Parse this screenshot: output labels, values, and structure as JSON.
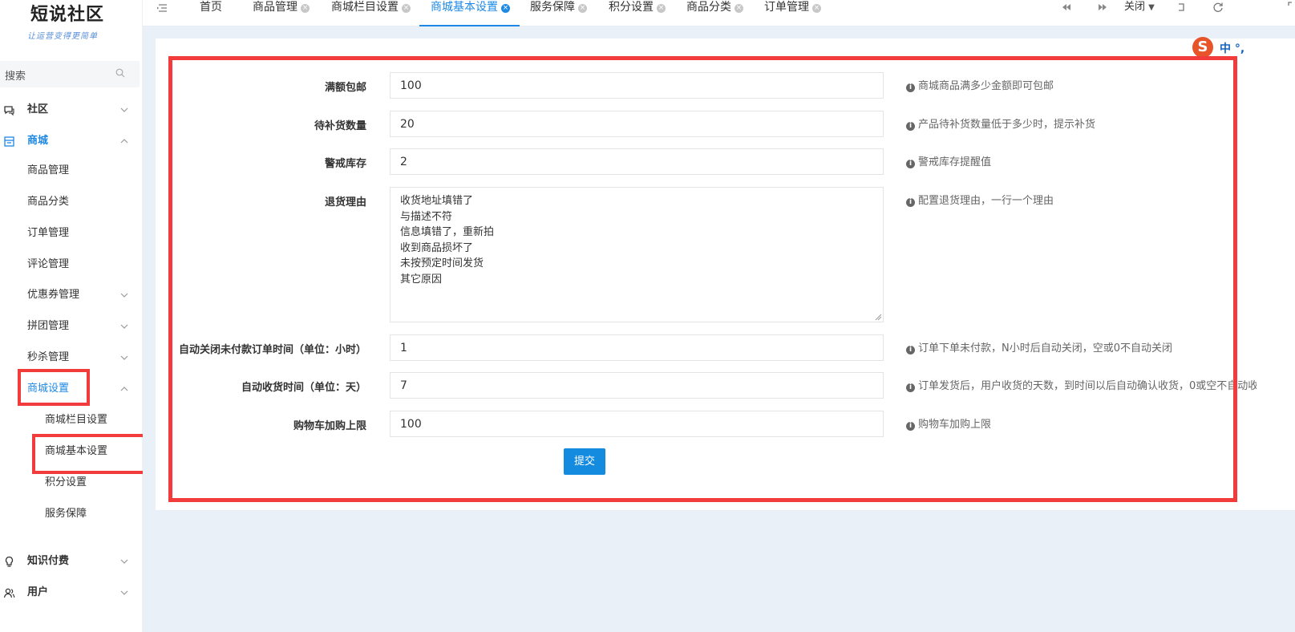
{
  "brand": {
    "title": "短说社区",
    "subtitle": "让运营变得更简单"
  },
  "sidebar": {
    "search_placeholder": "搜索",
    "items": [
      {
        "label": "社区"
      },
      {
        "label": "商城"
      },
      {
        "label": "商品管理"
      },
      {
        "label": "商品分类"
      },
      {
        "label": "订单管理"
      },
      {
        "label": "评论管理"
      },
      {
        "label": "优惠券管理"
      },
      {
        "label": "拼团管理"
      },
      {
        "label": "秒杀管理"
      },
      {
        "label": "商城设置"
      },
      {
        "label": "商城栏目设置"
      },
      {
        "label": "商城基本设置"
      },
      {
        "label": "积分设置"
      },
      {
        "label": "服务保障"
      },
      {
        "label": "知识付费"
      },
      {
        "label": "用户"
      }
    ]
  },
  "tabs": [
    {
      "label": "首页"
    },
    {
      "label": "商品管理"
    },
    {
      "label": "商城栏目设置"
    },
    {
      "label": "商城基本设置"
    },
    {
      "label": "服务保障"
    },
    {
      "label": "积分设置"
    },
    {
      "label": "商品分类"
    },
    {
      "label": "订单管理"
    }
  ],
  "toolbar": {
    "close_label": "关闭"
  },
  "ime": {
    "label": "中 °,"
  },
  "form": {
    "fields": [
      {
        "label": "满额包邮",
        "value": "100",
        "help": "商城商品满多少金额即可包邮"
      },
      {
        "label": "待补货数量",
        "value": "20",
        "help": "产品待补货数量低于多少时，提示补货"
      },
      {
        "label": "警戒库存",
        "value": "2",
        "help": "警戒库存提醒值"
      },
      {
        "label": "退货理由",
        "value": "收货地址填错了\n与描述不符\n信息填错了，重新拍\n收到商品损坏了\n未按预定时间发货\n其它原因",
        "help": "配置退货理由，一行一个理由"
      },
      {
        "label": "自动关闭未付款订单时间（单位：小时）",
        "value": "1",
        "help": "订单下单未付款，N小时后自动关闭，空或0不自动关闭"
      },
      {
        "label": "自动收货时间（单位：天）",
        "value": "7",
        "help": "订单发货后，用户收货的天数，到时间以后自动确认收货，0或空不自动收货"
      },
      {
        "label": "购物车加购上限",
        "value": "100",
        "help": "购物车加购上限"
      }
    ],
    "submit_label": "提交"
  }
}
